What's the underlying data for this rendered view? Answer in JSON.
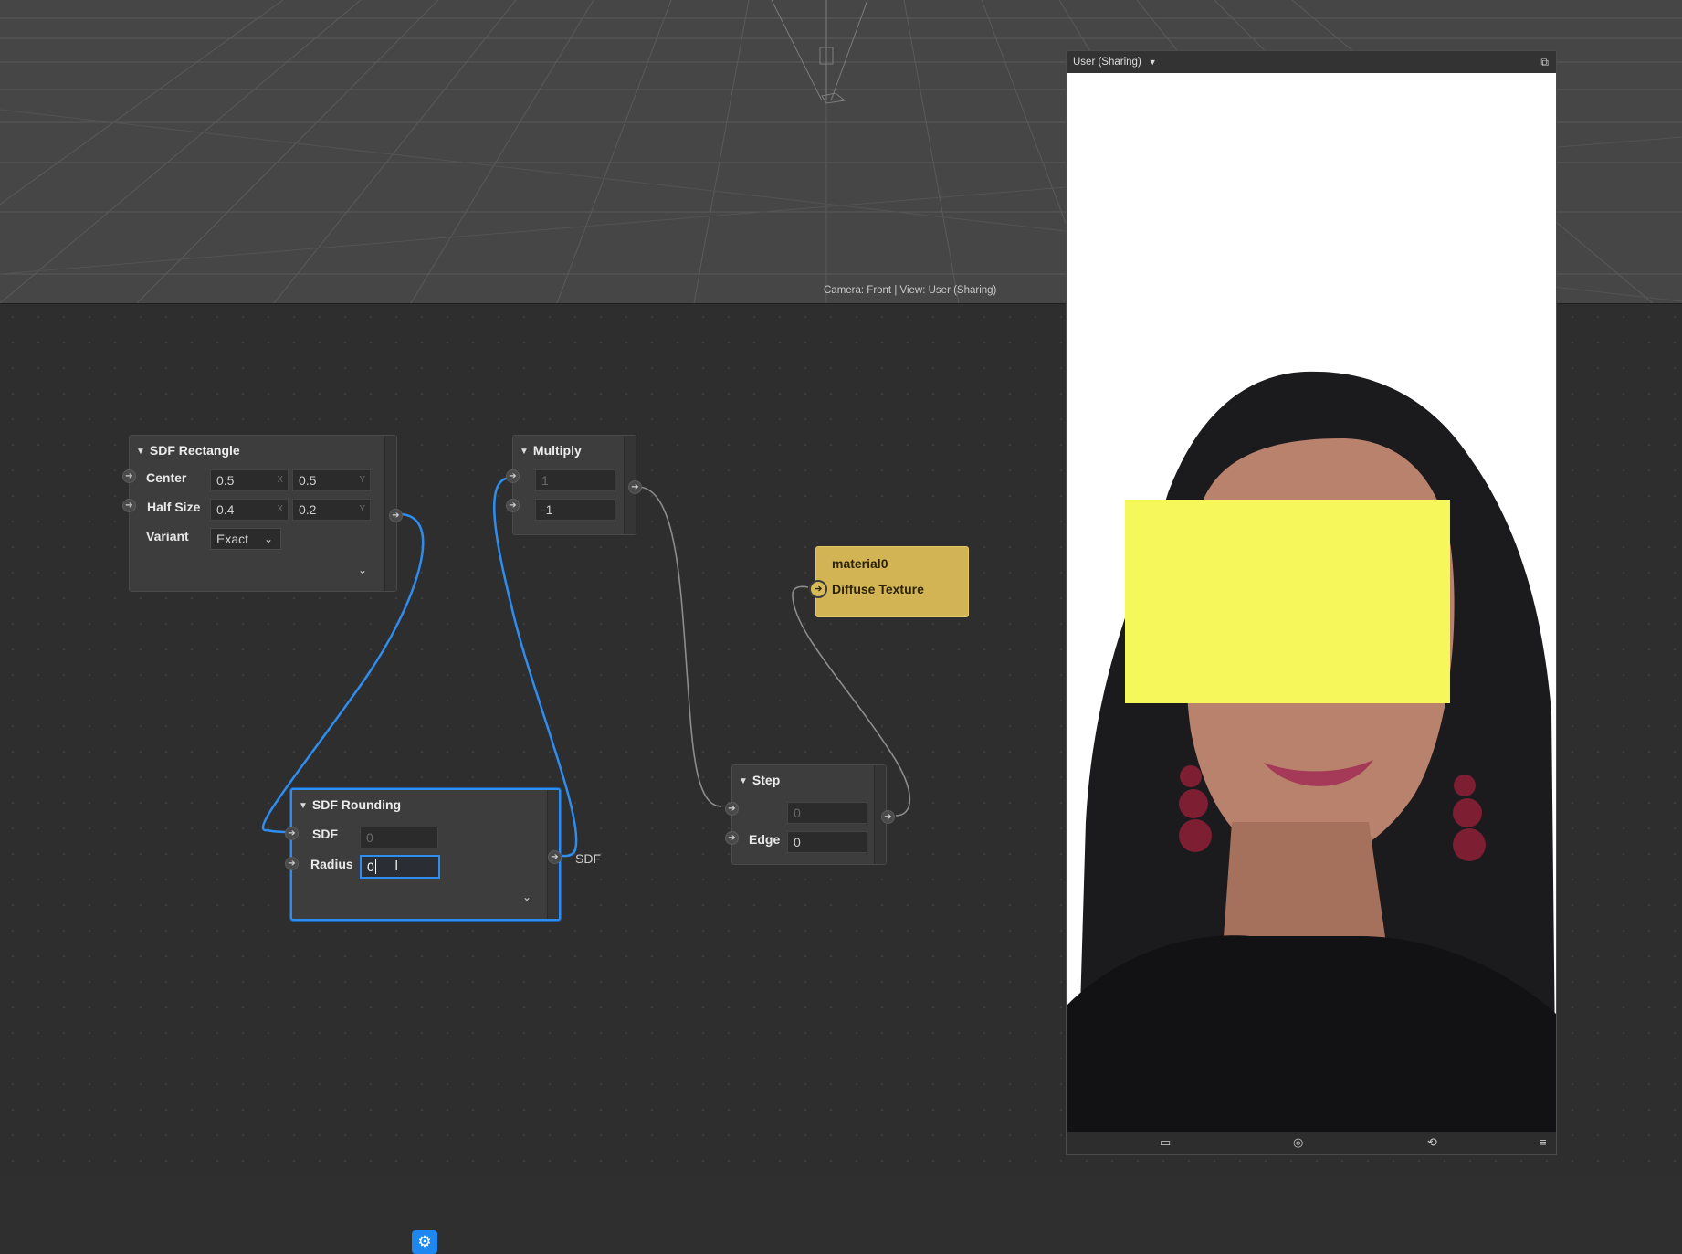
{
  "viewport": {
    "camera_info": "Camera: Front | View: User (Sharing)"
  },
  "nodes": {
    "sdf_rectangle": {
      "title": "SDF Rectangle",
      "center_label": "Center",
      "center_x": "0.5",
      "center_y": "0.5",
      "half_size_label": "Half Size",
      "half_size_x": "0.4",
      "half_size_y": "0.2",
      "variant_label": "Variant",
      "variant_value": "Exact",
      "axis_x": "X",
      "axis_y": "Y"
    },
    "multiply": {
      "title": "Multiply",
      "input_a": "1",
      "input_b": "-1"
    },
    "sdf_rounding": {
      "title": "SDF Rounding",
      "sdf_label": "SDF",
      "sdf_value": "0",
      "radius_label": "Radius",
      "radius_value": "0",
      "output_label": "SDF"
    },
    "step": {
      "title": "Step",
      "input_value": "0",
      "edge_label": "Edge",
      "edge_value": "0"
    },
    "material": {
      "title": "material0",
      "input_label": "Diffuse Texture"
    }
  },
  "preview": {
    "title": "User (Sharing)",
    "overlay_color": "#f5f75a"
  },
  "icons": {
    "port": "arrow-right",
    "collapse": "triangle-down",
    "expand": "chevron-down",
    "settings": "gear",
    "footer": [
      "video-camera",
      "screenshot-camera",
      "rotate-device",
      "menu"
    ]
  }
}
